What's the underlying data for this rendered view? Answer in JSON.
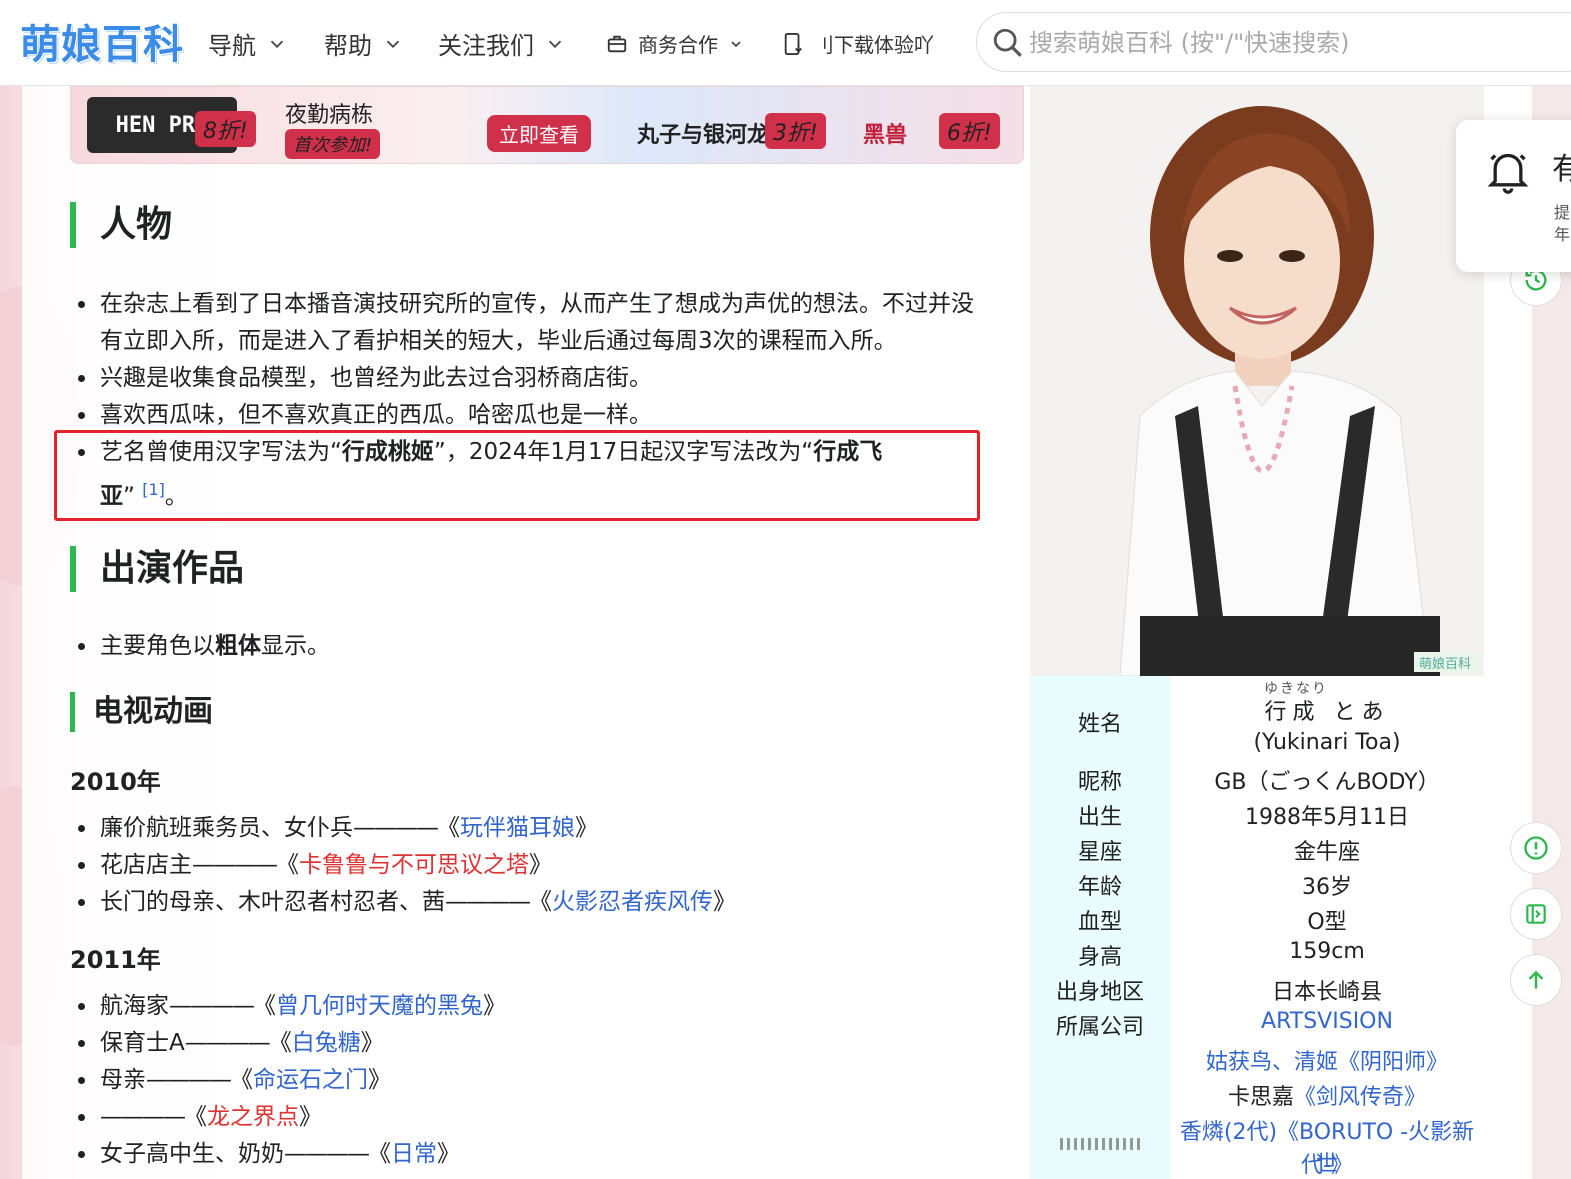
{
  "header": {
    "logo": "萌娘百科",
    "nav": [
      {
        "label": "导航"
      },
      {
        "label": "帮助"
      },
      {
        "label": "关注我们"
      }
    ],
    "business": "商务合作",
    "download": "刂下载体验吖",
    "search_placeholder": "搜索萌娘百科 (按\"/\"快速搜索)"
  },
  "banner": {
    "item1": "HEN PRI",
    "tag1": "8折!",
    "item2": "夜勤病栋",
    "tag2": "首次参加!",
    "cta": "立即查看",
    "item3": "丸子与银河龙",
    "tag3": "3折!",
    "item4": "黑兽",
    "tag4": "6折!"
  },
  "sections": {
    "person": {
      "title": "人物",
      "items": [
        "在杂志上看到了日本播音演技研究所的宣传，从而产生了想成为声优的想法。不过并没",
        "有立即入所，而是进入了看护相关的短大，毕业后通过每周3次的课程而入所。",
        "兴趣是收集食品模型，也曾经为此去过合羽桥商店街。",
        "喜欢西瓜味，但不喜欢真正的西瓜。哈密瓜也是一样。"
      ],
      "stagename_pre": "艺名曾使用汉字写法为“",
      "stagename_old": "行成桃姬",
      "stagename_mid": "”，2024年1月17日起汉字写法改为“",
      "stagename_new_a": "行成飞",
      "stagename_new_b": "亚",
      "stagename_post": "”",
      "ref": "[1]",
      "end": "。"
    },
    "works": {
      "title": "出演作品",
      "note_pre": "主要角色以",
      "note_bold": "粗体",
      "note_post": "显示。"
    },
    "tv": {
      "title": "电视动画",
      "years": [
        {
          "year": "2010年",
          "entries": [
            {
              "role": "廉价航班乘务员、女仆兵",
              "dash": "————",
              "open": "《",
              "title": "玩伴猫耳娘",
              "close": "》",
              "link": "blue"
            },
            {
              "role": "花店店主",
              "dash": "————",
              "open": "《",
              "title": "卡鲁鲁与不可思议之塔",
              "close": "》",
              "link": "red"
            },
            {
              "role": "长门的母亲、木叶忍者村忍者、茜",
              "dash": "————",
              "open": "《",
              "title": "火影忍者疾风传",
              "close": "》",
              "link": "blue"
            }
          ]
        },
        {
          "year": "2011年",
          "entries": [
            {
              "role": "航海家",
              "dash": "————",
              "open": "《",
              "title": "曾几何时天魔的黑兔",
              "close": "》",
              "link": "blue"
            },
            {
              "role": "保育士A",
              "dash": "————",
              "open": "《",
              "title": "白兔糖",
              "close": "》",
              "link": "blue"
            },
            {
              "role": "母亲",
              "dash": "————",
              "open": "《",
              "title": "命运石之门",
              "close": "》",
              "link": "blue"
            },
            {
              "role": "",
              "dash": "————",
              "open": "《",
              "title": "龙之界点",
              "close": "》",
              "link": "red"
            },
            {
              "role": "女子高中生、奶奶",
              "dash": "————",
              "open": "《",
              "title": "日常",
              "close": "》",
              "link": "blue"
            }
          ]
        }
      ]
    }
  },
  "infobox": {
    "name_label": "姓名",
    "name_ruby": "ゆきなり",
    "name_kanji": "行成",
    "name_kana": "とあ",
    "name_romaji": "(Yukinari Toa)",
    "nickname_label": "昵称",
    "nickname": "GB（ごっくんBODY）",
    "birth_label": "出生",
    "birth": "1988年5月11日",
    "zodiac_label": "星座",
    "zodiac": "金牛座",
    "age_label": "年龄",
    "age": "36岁",
    "blood_label": "血型",
    "blood": "O型",
    "height_label": "身高",
    "height": "159cm",
    "origin_label": "出身地区",
    "origin": "日本长崎县",
    "company_label": "所属公司",
    "company": "ARTSVISION",
    "roles1_a": "姑获鸟、清姬",
    "roles1_b": "《阴阳师》",
    "roles2_a": "卡思嘉",
    "roles2_b": "《剑风传奇》",
    "roles3_a": "香燐(2代)",
    "roles3_b": "《BORUTO -火影新世",
    "roles3_c": "代-》",
    "watermark": "萌娘百科"
  },
  "notify": {
    "title": "有",
    "sub1": "提",
    "sub2": "年"
  },
  "colors": {
    "accent_green": "#2fb64f",
    "link_blue": "#3366cc",
    "link_red": "#d33",
    "highlight_box": "#e5222c",
    "infobox_label_bg": "#e9fcfe"
  }
}
